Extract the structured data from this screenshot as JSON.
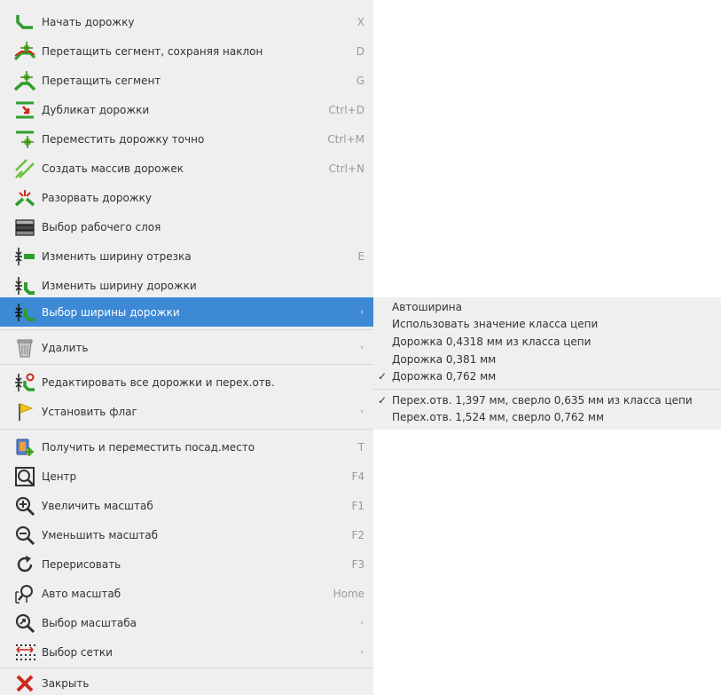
{
  "menu": {
    "items": [
      {
        "label": "Начать дорожку",
        "shortcut": "X",
        "icon": "start-track-icon"
      },
      {
        "label": "Перетащить сегмент, сохраняя наклон",
        "shortcut": "D",
        "icon": "drag-segment-keep-slope-icon"
      },
      {
        "label": "Перетащить сегмент",
        "shortcut": "G",
        "icon": "drag-segment-icon"
      },
      {
        "label": "Дубликат дорожки",
        "shortcut": "Ctrl+D",
        "icon": "duplicate-track-icon"
      },
      {
        "label": "Переместить дорожку точно",
        "shortcut": "Ctrl+M",
        "icon": "move-track-exact-icon"
      },
      {
        "label": "Создать массив дорожек",
        "shortcut": "Ctrl+N",
        "icon": "track-array-icon"
      },
      {
        "label": "Разорвать дорожку",
        "shortcut": "",
        "icon": "break-track-icon"
      },
      {
        "label": "Выбор рабочего слоя",
        "shortcut": "",
        "icon": "layer-select-icon"
      },
      {
        "label": "Изменить ширину отрезка",
        "shortcut": "E",
        "icon": "segment-width-icon"
      },
      {
        "label": "Изменить ширину дорожки",
        "shortcut": "",
        "icon": "track-width-icon"
      },
      {
        "label": "Выбор ширины дорожки",
        "shortcut": "",
        "icon": "track-width-select-icon"
      },
      {
        "label": "Удалить",
        "shortcut": "",
        "icon": "trash-icon"
      },
      {
        "label": "Редактировать все дорожки и перех.отв.",
        "shortcut": "",
        "icon": "edit-tracks-vias-icon"
      },
      {
        "label": "Установить флаг",
        "shortcut": "",
        "icon": "flag-icon"
      },
      {
        "label": "Получить и переместить посад.место",
        "shortcut": "T",
        "icon": "get-move-footprint-icon"
      },
      {
        "label": "Центр",
        "shortcut": "F4",
        "icon": "zoom-center-icon"
      },
      {
        "label": "Увеличить масштаб",
        "shortcut": "F1",
        "icon": "zoom-in-icon"
      },
      {
        "label": "Уменьшить масштаб",
        "shortcut": "F2",
        "icon": "zoom-out-icon"
      },
      {
        "label": "Перерисовать",
        "shortcut": "F3",
        "icon": "redraw-icon"
      },
      {
        "label": "Авто масштаб",
        "shortcut": "Home",
        "icon": "zoom-fit-icon"
      },
      {
        "label": "Выбор масштаба",
        "shortcut": "",
        "icon": "zoom-select-icon"
      },
      {
        "label": "Выбор сетки",
        "shortcut": "",
        "icon": "grid-select-icon"
      },
      {
        "label": "Закрыть",
        "shortcut": "",
        "icon": "close-icon"
      }
    ],
    "submenu_arrow": "›"
  },
  "submenu": {
    "items": [
      {
        "label": "Автоширина",
        "checked": false
      },
      {
        "label": "Использовать значение класса цепи",
        "checked": false
      },
      {
        "label": "Дорожка 0,4318 мм из класса цепи",
        "checked": false
      },
      {
        "label": "Дорожка 0,381 мм",
        "checked": false
      },
      {
        "label": "Дорожка 0,762 мм",
        "checked": true
      },
      {
        "label": "Перех.отв. 1,397 мм, сверло 0,635 мм из класса цепи",
        "checked": true
      },
      {
        "label": "Перех.отв. 1,524 мм, сверло 0,762 мм",
        "checked": false
      }
    ],
    "check_glyph": "✓"
  },
  "colors": {
    "menu_bg": "#efefef",
    "highlight": "#3d89d6",
    "shortcut_text": "#9a9a9a",
    "icon_green": "#2e9e2e",
    "icon_red": "#cc2a1e"
  }
}
